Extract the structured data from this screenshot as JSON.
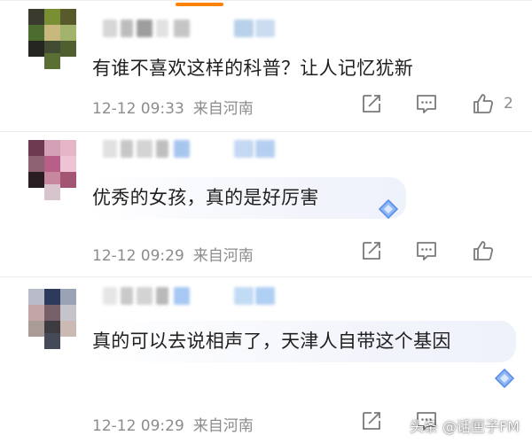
{
  "comments": [
    {
      "text": "有谁不喜欢这样的科普？让人记忆犹新",
      "time": "12-12 09:33",
      "location": "来自河南",
      "likes": "2",
      "avatar_colors": [
        "#3a3a2e",
        "#7a8f33",
        "#595a2c",
        "#4d6d30",
        "#c9b87e",
        "#a4b36b",
        "#262621",
        "#424c33",
        "#4f5f2f",
        "#5b6e34"
      ],
      "name_colors": [
        "#d6d6d6",
        "#bdbdbd",
        "#9e9e9e",
        "#e2e2e2",
        "#c5c5c5",
        "#b8d0e9",
        "#cbdcf0"
      ]
    },
    {
      "text": "优秀的女孩，真的是好厉害",
      "time": "12-12 09:29",
      "location": "来自河南",
      "likes": "",
      "avatar_colors": [
        "#6d3a52",
        "#d2a1b6",
        "#e5b6c8",
        "#8e6273",
        "#b75f86",
        "#eec3d3",
        "#2a1d22",
        "#c9879f",
        "#a35574",
        "#d8c4cc"
      ],
      "name_colors": [
        "#e0e0e0",
        "#c7c7c7",
        "#d4d4d4",
        "#bfbfbf",
        "#a7c6ee",
        "#c3d8f3",
        "#b4cff0"
      ]
    },
    {
      "text": "真的可以去说相声了，天津人自带这个基因",
      "time": "12-12 09:29",
      "location": "来自河南",
      "likes": "",
      "avatar_colors": [
        "#b8bcc9",
        "#2e3a5c",
        "#9aa3b5",
        "#c3a5a8",
        "#786068",
        "#c4c4cc",
        "#a99c97",
        "#3d3a40",
        "#cbbab3",
        "#444a58"
      ],
      "name_colors": [
        "#e6e6e6",
        "#c9c9c9",
        "#d3d3d3",
        "#b9b9b9",
        "#a6c8f2",
        "#c2dbf5",
        "#b0d0f3"
      ]
    }
  ],
  "watermark": "头条 @话匣子FM",
  "colors": {
    "accent": "#ff8200",
    "meta_gray": "#8c8c8c",
    "badge_blue": "#5b8ee8"
  }
}
